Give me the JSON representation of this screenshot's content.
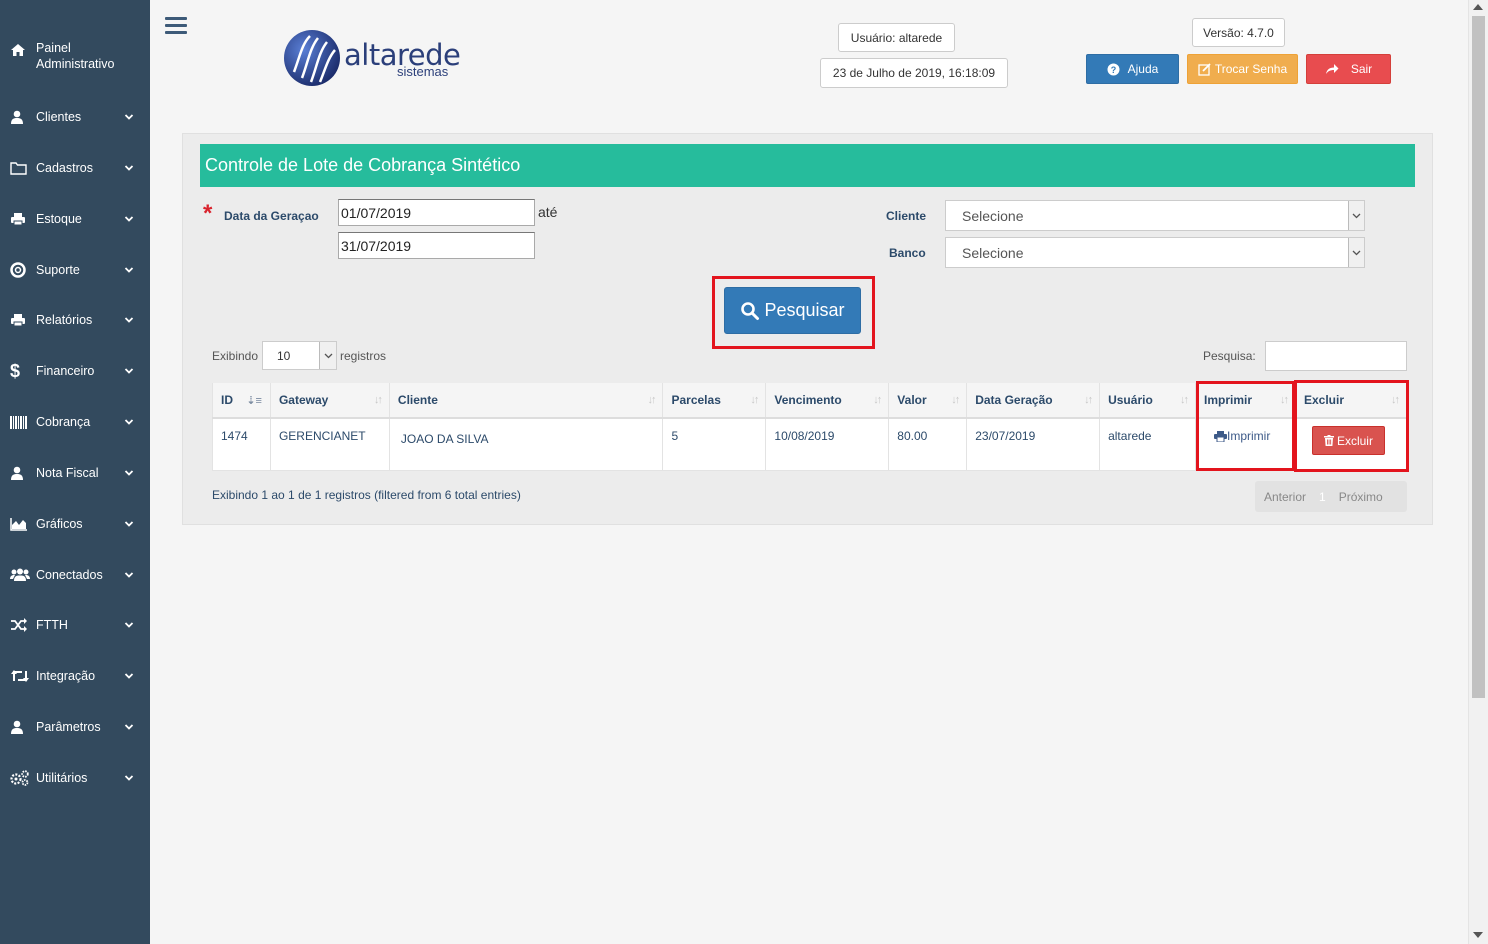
{
  "sidebar": {
    "items": [
      {
        "label": "Painel Administrativo",
        "icon": "home-icon"
      },
      {
        "label": "Clientes",
        "icon": "user-icon"
      },
      {
        "label": "Cadastros",
        "icon": "folder-icon"
      },
      {
        "label": "Estoque",
        "icon": "print-icon"
      },
      {
        "label": "Suporte",
        "icon": "life-ring-icon"
      },
      {
        "label": "Relatórios",
        "icon": "print-icon"
      },
      {
        "label": "Financeiro",
        "icon": "dollar-icon"
      },
      {
        "label": "Cobrança",
        "icon": "barcode-icon"
      },
      {
        "label": "Nota Fiscal",
        "icon": "user-icon"
      },
      {
        "label": "Gráficos",
        "icon": "area-chart-icon"
      },
      {
        "label": "Conectados",
        "icon": "users-icon"
      },
      {
        "label": "FTTH",
        "icon": "random-icon"
      },
      {
        "label": "Integração",
        "icon": "retweet-icon"
      },
      {
        "label": "Parâmetros",
        "icon": "user-icon"
      },
      {
        "label": "Utilitários",
        "icon": "cogs-icon"
      }
    ]
  },
  "header": {
    "logo_brand": "altarede",
    "logo_sub": "sistemas",
    "user": "Usuário: altarede",
    "datetime": "23 de Julho de 2019, 16:18:09",
    "version": "Versão: 4.7.0",
    "btn_ajuda": "Ajuda",
    "btn_senha": "Trocar Senha",
    "btn_sair": "Sair"
  },
  "form": {
    "title": "Controle de Lote de Cobrança Sintético",
    "data_label": "Data da Geraçao",
    "date_from": "01/07/2019",
    "ate": "até",
    "date_to": "31/07/2019",
    "cliente_label": "Cliente",
    "cliente_value": "Selecione",
    "banco_label": "Banco",
    "banco_value": "Selecione",
    "search_button": "Pesquisar"
  },
  "table_controls": {
    "exibindo": "Exibindo",
    "page_length": "10",
    "registros": "registros",
    "pesquisa": "Pesquisa:"
  },
  "table": {
    "columns": [
      "ID",
      "Gateway",
      "Cliente",
      "Parcelas",
      "Vencimento",
      "Valor",
      "Data Geração",
      "Usuário",
      "Imprimir",
      "Excluir"
    ],
    "rows": [
      {
        "id": "1474",
        "gateway": "GERENCIANET",
        "cliente": "JOAO DA SILVA",
        "parcelas": "5",
        "vencimento": "10/08/2019",
        "valor": "80.00",
        "data_geracao": "23/07/2019",
        "usuario": "altarede",
        "imprimir": "Imprimir",
        "excluir": "Excluir"
      }
    ]
  },
  "footer": {
    "info": "Exibindo 1 ao 1 de 1 registros (filtered from 6 total entries)",
    "prev": "Anterior",
    "page": "1",
    "next": "Próximo"
  },
  "colors": {
    "sidebar_bg": "#334a5e",
    "title_bar": "#26bc9c",
    "primary": "#337ab7",
    "warning": "#f0ad4e",
    "danger": "#d9534f",
    "highlight": "#e3141d"
  }
}
